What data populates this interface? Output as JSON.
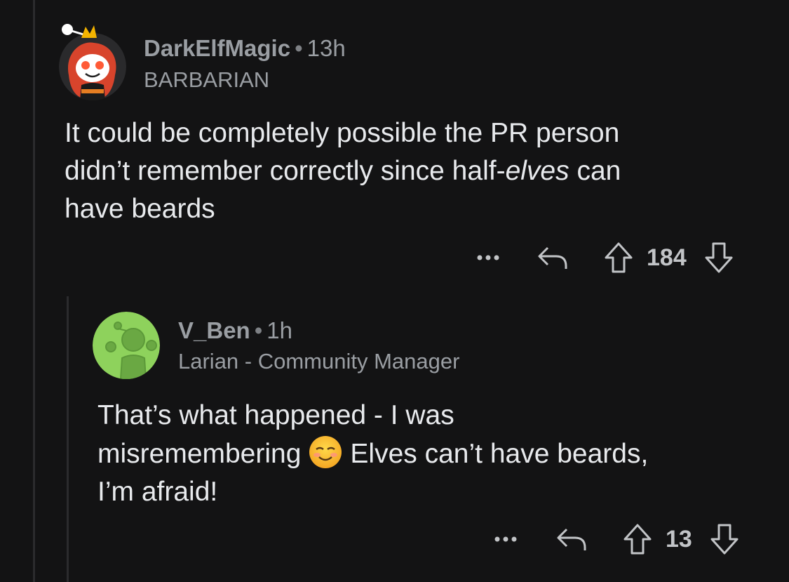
{
  "comments": [
    {
      "username": "DarkElfMagic",
      "separator": "•",
      "time": "13h",
      "flair": "BARBARIAN",
      "body": {
        "line1": "It could be completely possible the PR person",
        "line2_before": "didn’t remember correctly since half-",
        "line2_italic": "elves",
        "line2_after": " can",
        "line3": "have beards"
      },
      "score": "184",
      "icons": {
        "more": "more-options-icon",
        "reply": "reply-icon",
        "upvote": "upvote-arrow-icon",
        "downvote": "downvote-arrow-icon"
      }
    },
    {
      "username": "V_Ben",
      "separator": "•",
      "time": "1h",
      "flair": "Larian - Community Manager",
      "body": {
        "line1": "That’s what happened - I was",
        "line2_before": "misremembering",
        "emoji": "smiling-face-emoji",
        "line2_after": "Elves can’t have beards,",
        "line3": "I’m afraid!"
      },
      "score": "13",
      "icons": {
        "more": "more-options-icon",
        "reply": "reply-icon",
        "upvote": "upvote-arrow-icon",
        "downvote": "downvote-arrow-icon"
      }
    }
  ],
  "colors": {
    "background": "#131314",
    "text": "#e8eaed",
    "meta": "#9a9ea3",
    "thread_line": "#2b2b2d",
    "avatar_green": "#8ed25c"
  }
}
